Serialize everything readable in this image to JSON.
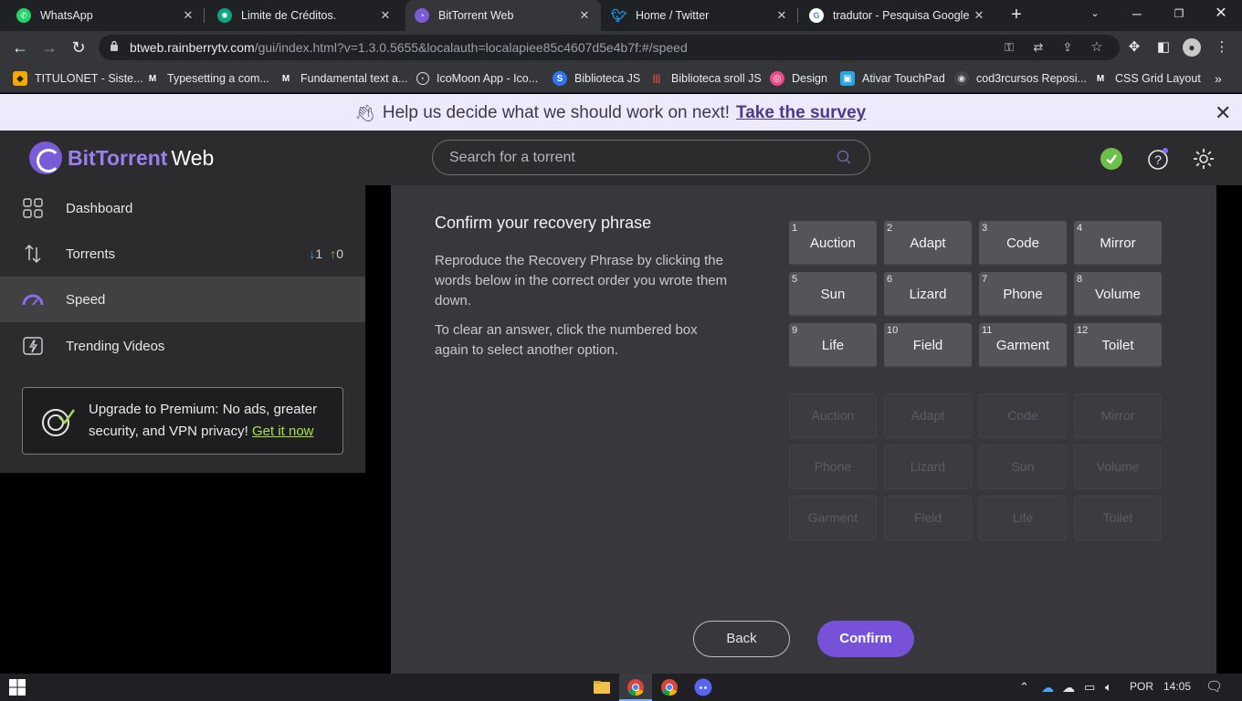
{
  "browser": {
    "tabs": [
      {
        "title": "WhatsApp",
        "icon": "whatsapp-icon",
        "color": "#25d366"
      },
      {
        "title": "Limite de Créditos.",
        "icon": "openai-icon",
        "color": "#10a37f"
      },
      {
        "title": "BitTorrent Web",
        "icon": "bittorrent-icon",
        "color": "#7a5bd8"
      },
      {
        "title": "Home / Twitter",
        "icon": "twitter-icon",
        "color": "#1d9bf0"
      },
      {
        "title": "tradutor - Pesquisa Google",
        "icon": "google-icon",
        "color": "#4285f4"
      }
    ],
    "url_host": "btweb.rainberrytv.com",
    "url_path": "/gui/index.html?v=1.3.0.5655&localauth=localapiee85c4607d5e4b7f:#/speed",
    "bookmarks": [
      {
        "label": "TITULONET - Siste...",
        "icon": "titulonet-icon"
      },
      {
        "label": "Typesetting a com...",
        "icon": "medium-icon"
      },
      {
        "label": "Fundamental text a...",
        "icon": "medium-icon"
      },
      {
        "label": "IcoMoon App - Ico...",
        "icon": "icomoon-icon"
      },
      {
        "label": "Biblioteca JS",
        "icon": "globe-icon"
      },
      {
        "label": "Biblioteca sroll JS",
        "icon": "bars-icon"
      },
      {
        "label": "Design",
        "icon": "dribbble-icon"
      },
      {
        "label": "Ativar TouchPad",
        "icon": "touchpad-icon"
      },
      {
        "label": "cod3rcursos Reposi...",
        "icon": "github-icon"
      },
      {
        "label": "CSS Grid Layout",
        "icon": "medium-icon"
      }
    ]
  },
  "banner": {
    "text": "Help us decide what we should work on next!",
    "link": "Take the survey"
  },
  "header": {
    "brand": "BitTorrent",
    "brand_suffix": "Web",
    "search_placeholder": "Search for a torrent"
  },
  "sidebar": {
    "items": [
      {
        "label": "Dashboard",
        "icon": "dashboard-icon"
      },
      {
        "label": "Torrents",
        "icon": "torrents-icon",
        "down": "1",
        "up": "0"
      },
      {
        "label": "Speed",
        "icon": "speed-icon",
        "active": true
      },
      {
        "label": "Trending Videos",
        "icon": "trending-videos-icon"
      }
    ],
    "promo_text": "Upgrade to Premium: No ads, greater security, and VPN privacy!",
    "promo_link": "Get it now"
  },
  "recovery": {
    "title": "Confirm your recovery phrase",
    "instructions": "Reproduce the Recovery Phrase by clicking the words below in the correct order you wrote them down.",
    "clear_hint": "To clear an answer, click the numbered box again to select another option.",
    "slots": [
      {
        "n": "1",
        "word": "Auction"
      },
      {
        "n": "2",
        "word": "Adapt"
      },
      {
        "n": "3",
        "word": "Code"
      },
      {
        "n": "4",
        "word": "Mirror"
      },
      {
        "n": "5",
        "word": "Sun"
      },
      {
        "n": "6",
        "word": "Lizard"
      },
      {
        "n": "7",
        "word": "Phone"
      },
      {
        "n": "8",
        "word": "Volume"
      },
      {
        "n": "9",
        "word": "Life"
      },
      {
        "n": "10",
        "word": "Field"
      },
      {
        "n": "11",
        "word": "Garment"
      },
      {
        "n": "12",
        "word": "Toilet"
      }
    ],
    "options": [
      "Auction",
      "Adapt",
      "Code",
      "Mirror",
      "Phone",
      "Lizard",
      "Sun",
      "Volume",
      "Garment",
      "Field",
      "Life",
      "Toilet"
    ],
    "back_label": "Back",
    "confirm_label": "Confirm"
  },
  "taskbar": {
    "language": "POR",
    "time": "14:05"
  },
  "colors": {
    "accent": "#7752d8",
    "promo_link": "#a6e04a",
    "upload": "#6cc04a",
    "download": "#4a9de0"
  }
}
